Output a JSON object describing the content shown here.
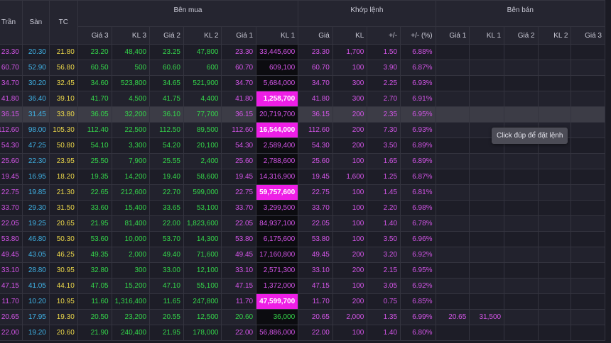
{
  "headers": {
    "ref": [
      "Trần",
      "Sàn",
      "TC"
    ],
    "groups": {
      "buy": "Bên mua",
      "match": "Khớp lệnh",
      "sell": "Bên bán"
    },
    "buy": [
      "Giá 3",
      "KL 3",
      "Giá 2",
      "KL 2",
      "Giá 1",
      "KL 1"
    ],
    "match": [
      "Giá",
      "KL",
      "+/-",
      "+/- (%)"
    ],
    "sell": [
      "Giá 1",
      "KL 1",
      "Giá 2",
      "KL 2",
      "Giá 3"
    ]
  },
  "tooltip": "Click đúp để đặt lệnh",
  "colors": {
    "ceiling": "#d455e8",
    "floor": "#3fb2e6",
    "reference": "#ecd84a",
    "up": "#34d54a",
    "highlight": "#ee1ee6"
  },
  "rows": [
    {
      "tran": "23.30",
      "san": "20.30",
      "tc": "21.80",
      "g3": "23.20",
      "kl3": "48,400",
      "g2": "23.25",
      "kl2": "47,800",
      "g1": "23.30",
      "kl1": "33,445,600",
      "gia": "23.30",
      "kl": "1,700",
      "chg": "1.50",
      "pct": "6.88%",
      "sg1": "",
      "skl1": "",
      "sg2": "",
      "skl2": "",
      "sg3": "",
      "pc": "purple",
      "g3c": "green",
      "g2c": "green",
      "g1c": "purple",
      "mc": "purple",
      "hl": false,
      "sel": false
    },
    {
      "tran": "60.70",
      "san": "52.90",
      "tc": "56.80",
      "g3": "60.50",
      "kl3": "500",
      "g2": "60.60",
      "kl2": "600",
      "g1": "60.70",
      "kl1": "609,100",
      "gia": "60.70",
      "kl": "100",
      "chg": "3.90",
      "pct": "6.87%",
      "sg1": "",
      "skl1": "",
      "sg2": "",
      "skl2": "",
      "sg3": "",
      "pc": "purple",
      "g3c": "green",
      "g2c": "green",
      "g1c": "purple",
      "mc": "purple",
      "hl": false,
      "sel": false
    },
    {
      "tran": "34.70",
      "san": "30.20",
      "tc": "32.45",
      "g3": "34.60",
      "kl3": "523,800",
      "g2": "34.65",
      "kl2": "521,900",
      "g1": "34.70",
      "kl1": "5,684,000",
      "gia": "34.70",
      "kl": "300",
      "chg": "2.25",
      "pct": "6.93%",
      "sg1": "",
      "skl1": "",
      "sg2": "",
      "skl2": "",
      "sg3": "",
      "pc": "purple",
      "g3c": "green",
      "g2c": "green",
      "g1c": "purple",
      "mc": "purple",
      "hl": false,
      "sel": false
    },
    {
      "tran": "41.80",
      "san": "36.40",
      "tc": "39.10",
      "g3": "41.70",
      "kl3": "4,500",
      "g2": "41.75",
      "kl2": "4,400",
      "g1": "41.80",
      "kl1": "1,258,700",
      "gia": "41.80",
      "kl": "300",
      "chg": "2.70",
      "pct": "6.91%",
      "sg1": "",
      "skl1": "",
      "sg2": "",
      "skl2": "",
      "sg3": "",
      "pc": "purple",
      "g3c": "green",
      "g2c": "green",
      "g1c": "purple",
      "mc": "purple",
      "hl": true,
      "sel": false
    },
    {
      "tran": "36.15",
      "san": "31.45",
      "tc": "33.80",
      "g3": "36.05",
      "kl3": "32,200",
      "g2": "36.10",
      "kl2": "77,700",
      "g1": "36.15",
      "kl1": "20,719,700",
      "gia": "36.15",
      "kl": "200",
      "chg": "2.35",
      "pct": "6.95%",
      "sg1": "",
      "skl1": "",
      "sg2": "",
      "skl2": "",
      "sg3": "",
      "pc": "purple",
      "g3c": "green",
      "g2c": "green",
      "g1c": "purple",
      "mc": "purple",
      "hl": false,
      "sel": true
    },
    {
      "tran": "112.60",
      "san": "98.00",
      "tc": "105.30",
      "g3": "112.40",
      "kl3": "22,500",
      "g2": "112.50",
      "kl2": "89,500",
      "g1": "112.60",
      "kl1": "16,544,000",
      "gia": "112.60",
      "kl": "200",
      "chg": "7.30",
      "pct": "6.93%",
      "sg1": "",
      "skl1": "",
      "sg2": "",
      "skl2": "",
      "sg3": "",
      "pc": "purple",
      "g3c": "green",
      "g2c": "green",
      "g1c": "purple",
      "mc": "purple",
      "hl": true,
      "sel": false
    },
    {
      "tran": "54.30",
      "san": "47.25",
      "tc": "50.80",
      "g3": "54.10",
      "kl3": "3,300",
      "g2": "54.20",
      "kl2": "20,100",
      "g1": "54.30",
      "kl1": "2,589,400",
      "gia": "54.30",
      "kl": "200",
      "chg": "3.50",
      "pct": "6.89%",
      "sg1": "",
      "skl1": "",
      "sg2": "",
      "skl2": "",
      "sg3": "",
      "pc": "purple",
      "g3c": "green",
      "g2c": "green",
      "g1c": "purple",
      "mc": "purple",
      "hl": false,
      "sel": false
    },
    {
      "tran": "25.60",
      "san": "22.30",
      "tc": "23.95",
      "g3": "25.50",
      "kl3": "7,900",
      "g2": "25.55",
      "kl2": "2,400",
      "g1": "25.60",
      "kl1": "2,788,600",
      "gia": "25.60",
      "kl": "100",
      "chg": "1.65",
      "pct": "6.89%",
      "sg1": "",
      "skl1": "",
      "sg2": "",
      "skl2": "",
      "sg3": "",
      "pc": "purple",
      "g3c": "green",
      "g2c": "green",
      "g1c": "purple",
      "mc": "purple",
      "hl": false,
      "sel": false
    },
    {
      "tran": "19.45",
      "san": "16.95",
      "tc": "18.20",
      "g3": "19.35",
      "kl3": "14,200",
      "g2": "19.40",
      "kl2": "58,600",
      "g1": "19.45",
      "kl1": "14,316,900",
      "gia": "19.45",
      "kl": "1,600",
      "chg": "1.25",
      "pct": "6.87%",
      "sg1": "",
      "skl1": "",
      "sg2": "",
      "skl2": "",
      "sg3": "",
      "pc": "purple",
      "g3c": "green",
      "g2c": "green",
      "g1c": "purple",
      "mc": "purple",
      "hl": false,
      "sel": false
    },
    {
      "tran": "22.75",
      "san": "19.85",
      "tc": "21.30",
      "g3": "22.65",
      "kl3": "212,600",
      "g2": "22.70",
      "kl2": "599,000",
      "g1": "22.75",
      "kl1": "59,757,600",
      "gia": "22.75",
      "kl": "100",
      "chg": "1.45",
      "pct": "6.81%",
      "sg1": "",
      "skl1": "",
      "sg2": "",
      "skl2": "",
      "sg3": "",
      "pc": "purple",
      "g3c": "green",
      "g2c": "green",
      "g1c": "purple",
      "mc": "purple",
      "hl": true,
      "sel": false
    },
    {
      "tran": "33.70",
      "san": "29.30",
      "tc": "31.50",
      "g3": "33.60",
      "kl3": "15,400",
      "g2": "33.65",
      "kl2": "53,100",
      "g1": "33.70",
      "kl1": "3,299,500",
      "gia": "33.70",
      "kl": "100",
      "chg": "2.20",
      "pct": "6.98%",
      "sg1": "",
      "skl1": "",
      "sg2": "",
      "skl2": "",
      "sg3": "",
      "pc": "purple",
      "g3c": "green",
      "g2c": "green",
      "g1c": "purple",
      "mc": "purple",
      "hl": false,
      "sel": false
    },
    {
      "tran": "22.05",
      "san": "19.25",
      "tc": "20.65",
      "g3": "21.95",
      "kl3": "81,400",
      "g2": "22.00",
      "kl2": "1,823,600",
      "g1": "22.05",
      "kl1": "84,937,100",
      "gia": "22.05",
      "kl": "100",
      "chg": "1.40",
      "pct": "6.78%",
      "sg1": "",
      "skl1": "",
      "sg2": "",
      "skl2": "",
      "sg3": "",
      "pc": "purple",
      "g3c": "green",
      "g2c": "green",
      "g1c": "purple",
      "mc": "purple",
      "hl": false,
      "sel": false
    },
    {
      "tran": "53.80",
      "san": "46.80",
      "tc": "50.30",
      "g3": "53.60",
      "kl3": "10,000",
      "g2": "53.70",
      "kl2": "14,300",
      "g1": "53.80",
      "kl1": "6,175,600",
      "gia": "53.80",
      "kl": "100",
      "chg": "3.50",
      "pct": "6.96%",
      "sg1": "",
      "skl1": "",
      "sg2": "",
      "skl2": "",
      "sg3": "",
      "pc": "purple",
      "g3c": "green",
      "g2c": "green",
      "g1c": "purple",
      "mc": "purple",
      "hl": false,
      "sel": false
    },
    {
      "tran": "49.45",
      "san": "43.05",
      "tc": "46.25",
      "g3": "49.35",
      "kl3": "2,000",
      "g2": "49.40",
      "kl2": "71,600",
      "g1": "49.45",
      "kl1": "17,160,800",
      "gia": "49.45",
      "kl": "200",
      "chg": "3.20",
      "pct": "6.92%",
      "sg1": "",
      "skl1": "",
      "sg2": "",
      "skl2": "",
      "sg3": "",
      "pc": "purple",
      "g3c": "green",
      "g2c": "green",
      "g1c": "purple",
      "mc": "purple",
      "hl": false,
      "sel": false
    },
    {
      "tran": "33.10",
      "san": "28.80",
      "tc": "30.95",
      "g3": "32.80",
      "kl3": "300",
      "g2": "33.00",
      "kl2": "12,100",
      "g1": "33.10",
      "kl1": "2,571,300",
      "gia": "33.10",
      "kl": "200",
      "chg": "2.15",
      "pct": "6.95%",
      "sg1": "",
      "skl1": "",
      "sg2": "",
      "skl2": "",
      "sg3": "",
      "pc": "purple",
      "g3c": "green",
      "g2c": "green",
      "g1c": "purple",
      "mc": "purple",
      "hl": false,
      "sel": false
    },
    {
      "tran": "47.15",
      "san": "41.05",
      "tc": "44.10",
      "g3": "47.05",
      "kl3": "15,200",
      "g2": "47.10",
      "kl2": "55,100",
      "g1": "47.15",
      "kl1": "1,372,000",
      "gia": "47.15",
      "kl": "100",
      "chg": "3.05",
      "pct": "6.92%",
      "sg1": "",
      "skl1": "",
      "sg2": "",
      "skl2": "",
      "sg3": "",
      "pc": "purple",
      "g3c": "green",
      "g2c": "green",
      "g1c": "purple",
      "mc": "purple",
      "hl": false,
      "sel": false
    },
    {
      "tran": "11.70",
      "san": "10.20",
      "tc": "10.95",
      "g3": "11.60",
      "kl3": "1,316,400",
      "g2": "11.65",
      "kl2": "247,800",
      "g1": "11.70",
      "kl1": "47,599,700",
      "gia": "11.70",
      "kl": "200",
      "chg": "0.75",
      "pct": "6.85%",
      "sg1": "",
      "skl1": "",
      "sg2": "",
      "skl2": "",
      "sg3": "",
      "pc": "purple",
      "g3c": "green",
      "g2c": "green",
      "g1c": "purple",
      "mc": "purple",
      "hl": true,
      "sel": false
    },
    {
      "tran": "20.65",
      "san": "17.95",
      "tc": "19.30",
      "g3": "20.50",
      "kl3": "23,200",
      "g2": "20.55",
      "kl2": "12,500",
      "g1": "20.60",
      "kl1": "36,000",
      "gia": "20.65",
      "kl": "2,000",
      "chg": "1.35",
      "pct": "6.99%",
      "sg1": "20.65",
      "skl1": "31,500",
      "sg2": "",
      "skl2": "",
      "sg3": "",
      "pc": "purple",
      "g3c": "green",
      "g2c": "green",
      "g1c": "green",
      "mc": "purple",
      "hl": false,
      "sel": false
    },
    {
      "tran": "22.00",
      "san": "19.20",
      "tc": "20.60",
      "g3": "21.90",
      "kl3": "240,400",
      "g2": "21.95",
      "kl2": "178,000",
      "g1": "22.00",
      "kl1": "56,886,000",
      "gia": "22.00",
      "kl": "100",
      "chg": "1.40",
      "pct": "6.80%",
      "sg1": "",
      "skl1": "",
      "sg2": "",
      "skl2": "",
      "sg3": "",
      "pc": "purple",
      "g3c": "green",
      "g2c": "green",
      "g1c": "purple",
      "mc": "purple",
      "hl": false,
      "sel": false
    }
  ]
}
